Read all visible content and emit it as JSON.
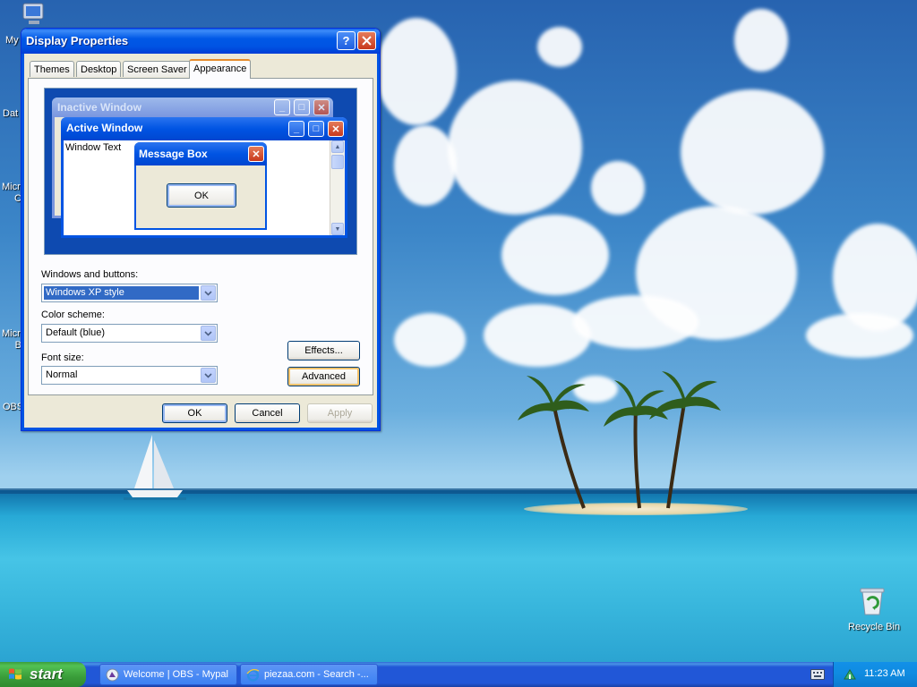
{
  "window": {
    "title": "Display Properties",
    "help_glyph": "?",
    "close_glyph": "✕",
    "tabs": [
      {
        "label": "Themes"
      },
      {
        "label": "Desktop"
      },
      {
        "label": "Screen Saver"
      },
      {
        "label": "Appearance",
        "active": true
      }
    ],
    "preview": {
      "inactive_title": "Inactive Window",
      "active_title": "Active Window",
      "window_text": "Window Text",
      "message_title": "Message Box",
      "ok_label": "OK"
    },
    "form": {
      "windows_buttons_label": "Windows and buttons:",
      "windows_buttons_value": "Windows XP style",
      "color_scheme_label": "Color scheme:",
      "color_scheme_value": "Default (blue)",
      "font_size_label": "Font size:",
      "font_size_value": "Normal",
      "effects_label": "Effects...",
      "advanced_label": "Advanced"
    },
    "footer": {
      "ok_label": "OK",
      "cancel_label": "Cancel",
      "apply_label": "Apply"
    }
  },
  "desktop": {
    "icons": [
      {
        "label": "My"
      },
      {
        "label": "Dat"
      },
      {
        "label": "Micro\nC"
      },
      {
        "label": "Micro\nB"
      },
      {
        "label": "OBS"
      }
    ],
    "recycle_bin_label": "Recycle Bin"
  },
  "taskbar": {
    "start_label": "start",
    "tasks": [
      {
        "label": "Welcome | OBS - Mypal",
        "icon": "mypal-icon"
      },
      {
        "label": "piezaa.com - Search -...",
        "icon": "ie-icon"
      }
    ],
    "clock": "11:23 AM"
  },
  "colors": {
    "xp_blue": "#0054e3",
    "start_green": "#3a9d3a",
    "selection": "#316ac5"
  }
}
